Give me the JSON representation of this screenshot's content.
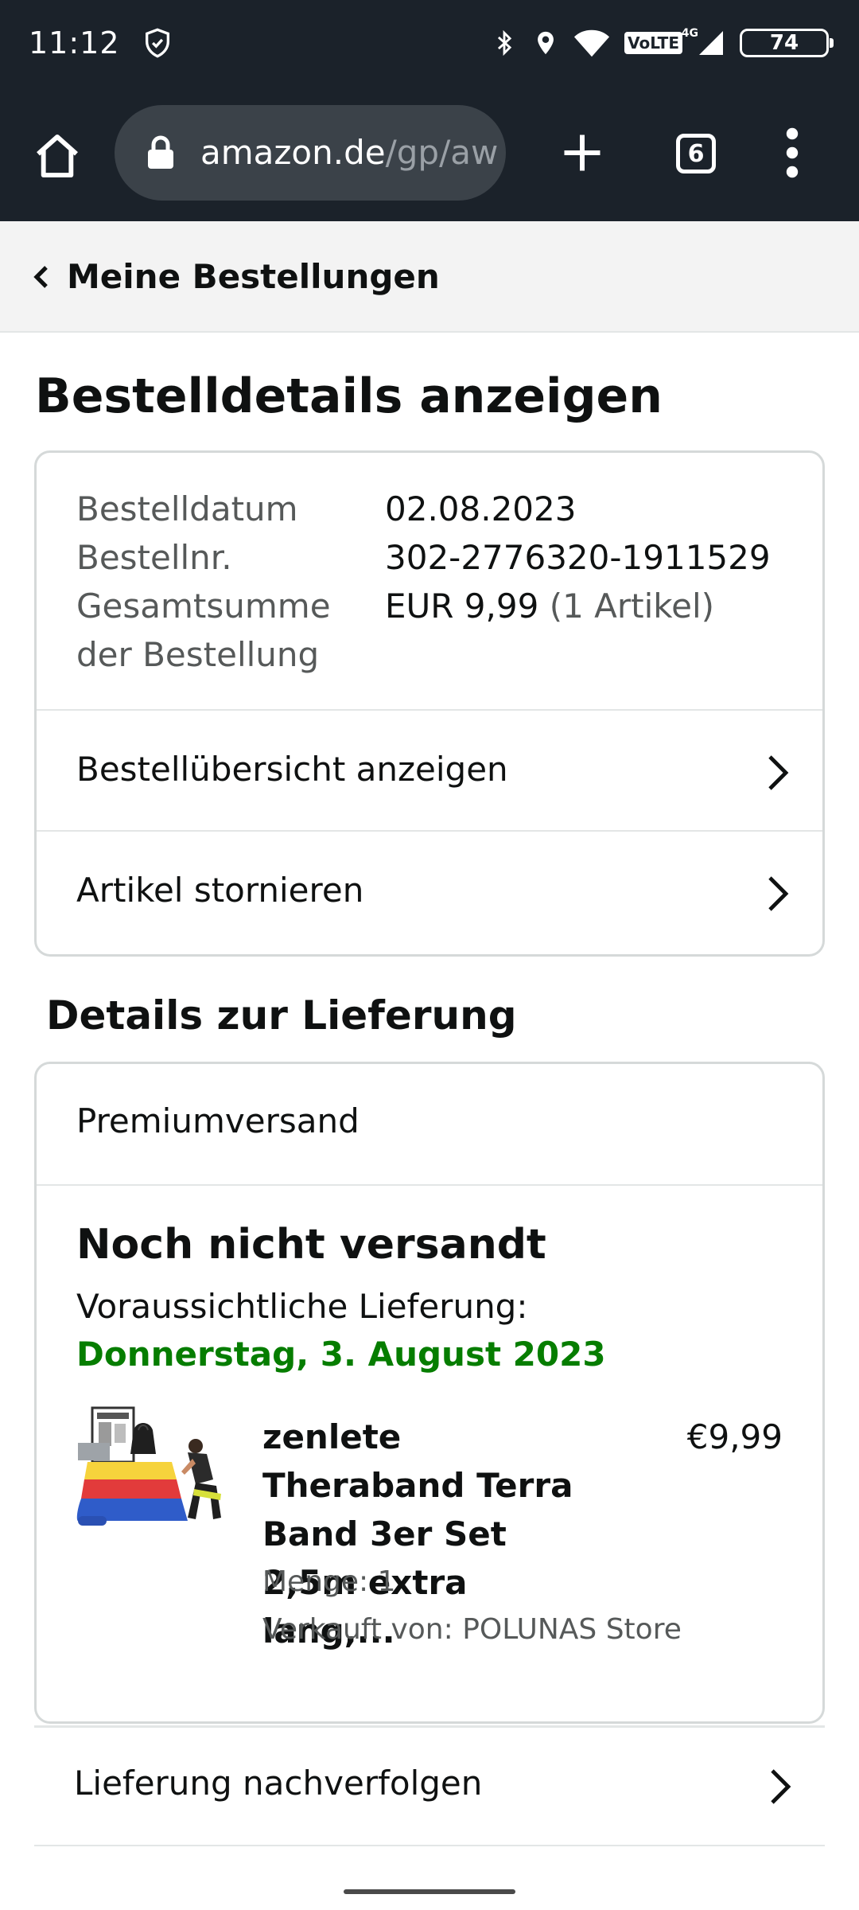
{
  "status_bar": {
    "time": "11:12",
    "network": "VoLTE",
    "network_gen": "4G",
    "battery": "74",
    "icons": [
      "shield-check-icon",
      "bluetooth-icon",
      "location-icon",
      "wifi-icon",
      "signal-icon",
      "battery-icon"
    ]
  },
  "browser": {
    "url_host": "amazon.de",
    "url_path": "/gp/aw",
    "tab_count": "6",
    "icons": [
      "home-icon",
      "lock-icon",
      "plus-icon",
      "more-vert-icon"
    ]
  },
  "nav": {
    "back_label": "Meine Bestellungen"
  },
  "page": {
    "title": "Bestelldetails anzeigen"
  },
  "order": {
    "date_label": "Bestelldatum",
    "date_value": "02.08.2023",
    "number_label": "Bestellnr.",
    "number_value": "302-2776320-1911529",
    "total_label_line1": "Gesamtsumme",
    "total_label_line2": "der Bestellung",
    "total_value": "EUR 9,99",
    "total_items": "(1 Artikel)",
    "actions": [
      {
        "label": "Bestellübersicht anzeigen"
      },
      {
        "label": "Artikel stornieren"
      }
    ]
  },
  "delivery": {
    "section_title": "Details zur Lieferung",
    "shipping_type": "Premiumversand",
    "status": "Noch nicht versandt",
    "expected_label": "Voraussichtliche Lieferung:",
    "expected_date": "Donnerstag, 3. August 2023",
    "expected_date_color": "#067d00",
    "item": {
      "title": "zenlete Theraband Terra Band 3er Set 2,5m extra lang,...",
      "price": "€9,99",
      "quantity": "Menge: 1",
      "seller": "Verkauft von: POLUNAS Store"
    },
    "track_label": "Lieferung nachverfolgen"
  },
  "colors": {
    "chrome_bg": "#1b222a",
    "url_pill_bg": "#3b4249",
    "back_bar_bg": "#f3f3f3",
    "card_border": "#d5d9d9",
    "text_primary": "#0f1111",
    "text_secondary": "#565959",
    "band_yellow": "#f6d33c",
    "band_red": "#e23b3b",
    "band_blue": "#2f5cc9"
  }
}
